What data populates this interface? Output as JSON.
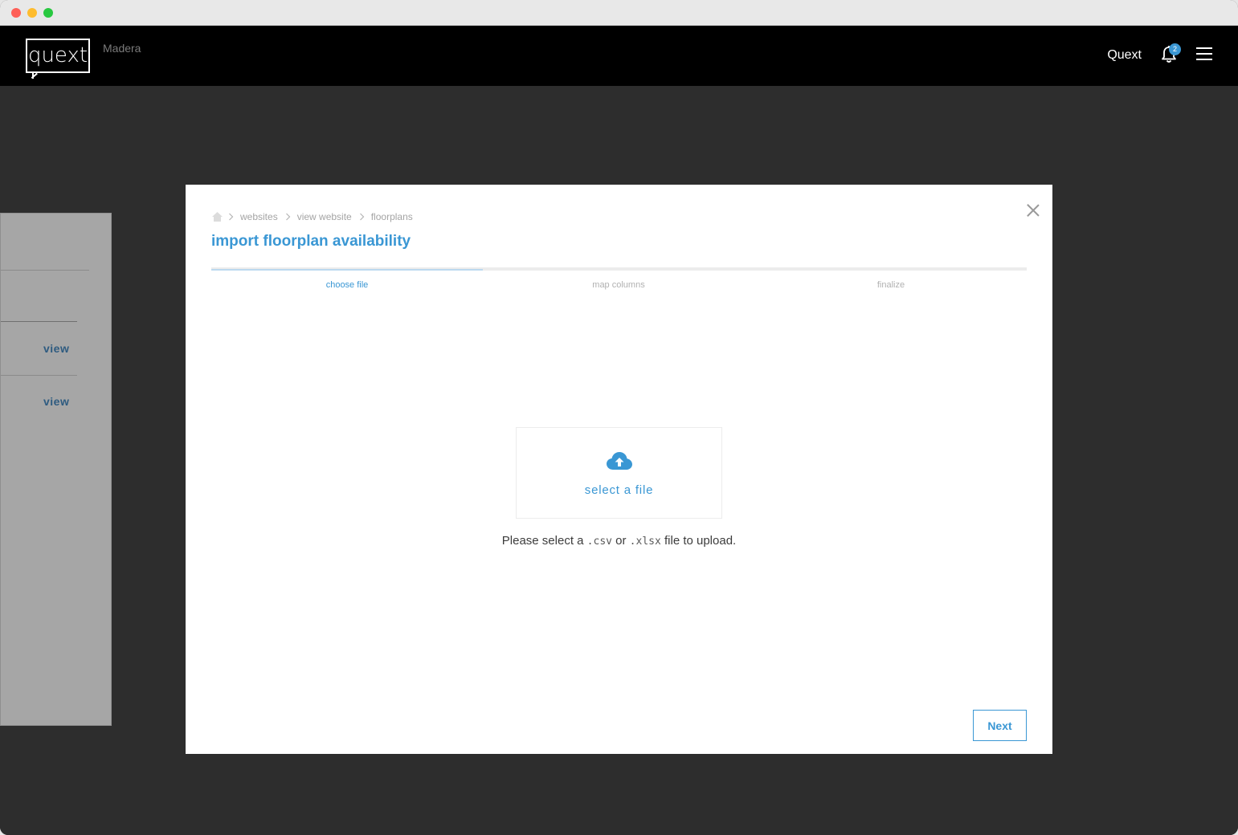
{
  "window": {
    "traffic_lights": [
      "close",
      "minimize",
      "zoom"
    ]
  },
  "topnav": {
    "logo_text": "quext",
    "property_name": "Madera",
    "user_name": "Quext",
    "notification_count": "2",
    "icons": {
      "notifications": "bell-icon",
      "menu": "hamburger-menu-icon"
    }
  },
  "background_page": {
    "rows": [
      {
        "action_label": "view"
      },
      {
        "action_label": "view"
      }
    ]
  },
  "modal": {
    "breadcrumb": {
      "home_icon": "home-icon",
      "items": [
        "websites",
        "view website",
        "floorplans"
      ]
    },
    "title": "import floorplan availability",
    "steps": [
      {
        "label": "choose file",
        "active": true
      },
      {
        "label": "map columns",
        "active": false
      },
      {
        "label": "finalize",
        "active": false
      }
    ],
    "progress_fraction": 0.333,
    "dropzone": {
      "icon": "cloud-upload-icon",
      "label": "select a file"
    },
    "hint": {
      "prefix": "Please select a ",
      "ext1": ".csv",
      "middle": " or ",
      "ext2": ".xlsx",
      "suffix": " file to upload."
    },
    "next_label": "Next",
    "close_icon": "close-icon"
  },
  "colors": {
    "accent": "#3a97d4",
    "nav_bg": "#000000",
    "overlay": "#2d2d2d",
    "badge": "#3b97d3"
  }
}
